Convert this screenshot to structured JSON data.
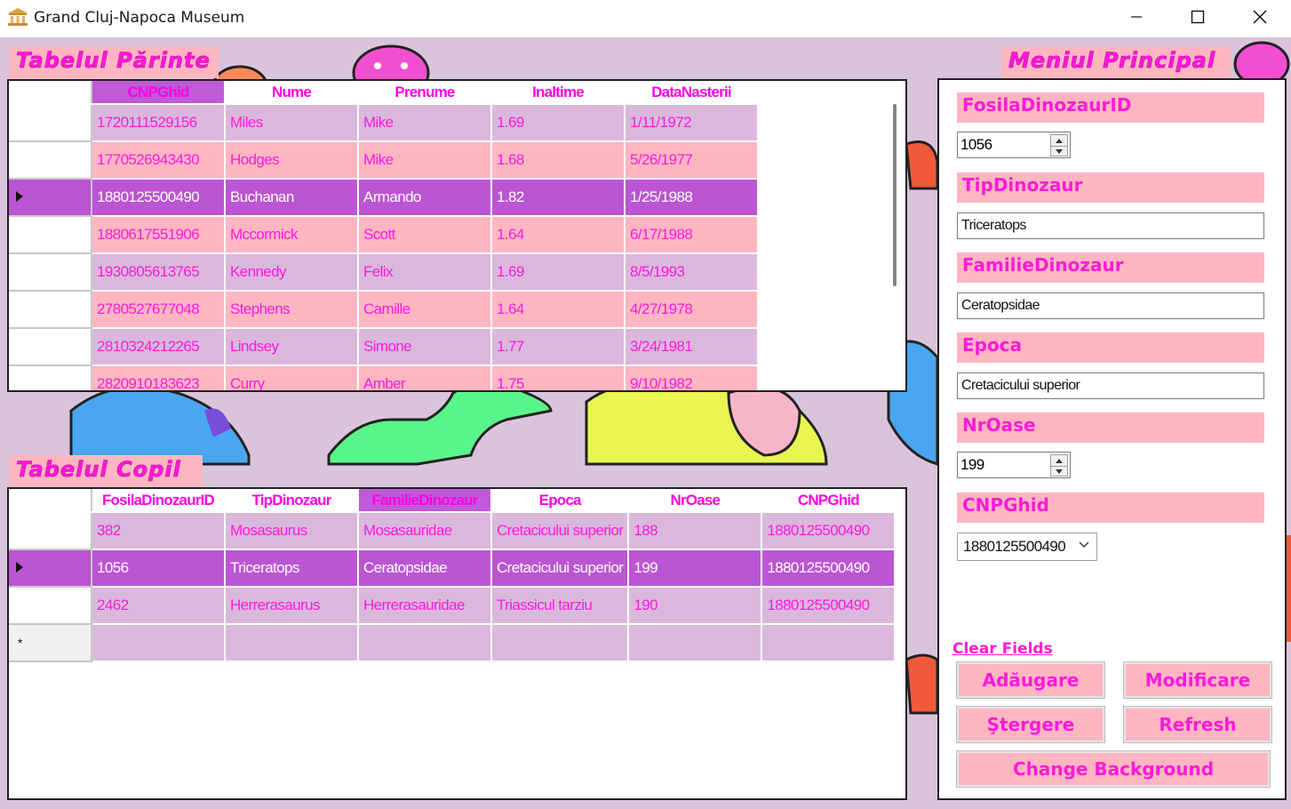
{
  "window": {
    "title": "Grand Cluj-Napoca Museum",
    "icon": "museum-icon"
  },
  "parent_section": {
    "title": "Tabelul Părinte",
    "columns": [
      "CNPGhid",
      "Nume",
      "Prenume",
      "Inaltime",
      "DataNasterii"
    ],
    "selected_column": "CNPGhid",
    "rows": [
      [
        "1720111529156",
        "Miles",
        "Mike",
        "1.69",
        "1/11/1972"
      ],
      [
        "1770526943430",
        "Hodges",
        "Mike",
        "1.68",
        "5/26/1977"
      ],
      [
        "1880125500490",
        "Buchanan",
        "Armando",
        "1.82",
        "1/25/1988"
      ],
      [
        "1880617551906",
        "Mccormick",
        "Scott",
        "1.64",
        "6/17/1988"
      ],
      [
        "1930805613765",
        "Kennedy",
        "Felix",
        "1.69",
        "8/5/1993"
      ],
      [
        "2780527677048",
        "Stephens",
        "Camille",
        "1.64",
        "4/27/1978"
      ],
      [
        "2810324212265",
        "Lindsey",
        "Simone",
        "1.77",
        "3/24/1981"
      ],
      [
        "2820910183623",
        "Curry",
        "Amber",
        "1.75",
        "9/10/1982"
      ]
    ],
    "selected_row": 2
  },
  "child_section": {
    "title": "Tabelul Copil",
    "columns": [
      "FosilaDinozaurID",
      "TipDinozaur",
      "FamilieDinozaur",
      "Epoca",
      "NrOase",
      "CNPGhid"
    ],
    "selected_column": "FamilieDinozaur",
    "rows": [
      [
        "382",
        "Mosasaurus",
        "Mosasauridae",
        "Cretacicului superior",
        "188",
        "1880125500490"
      ],
      [
        "1056",
        "Triceratops",
        "Ceratopsidae",
        "Cretacicului superior",
        "199",
        "1880125500490"
      ],
      [
        "2462",
        "Herrerasaurus",
        "Herrerasauridae",
        "Triassicul tarziu",
        "190",
        "1880125500490"
      ]
    ],
    "selected_row": 1
  },
  "menu": {
    "title": "Meniul Principal",
    "fields": {
      "fosila_label": "FosilaDinozaurID",
      "fosila_value": "1056",
      "tip_label": "TipDinozaur",
      "tip_value": "Triceratops",
      "familie_label": "FamilieDinozaur",
      "familie_value": "Ceratopsidae",
      "epoca_label": "Epoca",
      "epoca_value": "Cretacicului superior",
      "nroase_label": "NrOase",
      "nroase_value": "199",
      "cnp_label": "CNPGhid",
      "cnp_value": "1880125500490"
    },
    "clear_link": "Clear Fields",
    "buttons": {
      "add": "Adăugare",
      "modify": "Modificare",
      "delete": "Ştergere",
      "refresh": "Refresh",
      "background": "Change Background"
    }
  },
  "colors": {
    "accent_text": "#ff1ad9",
    "pink": "#ffb6c1",
    "lavender": "#dab8dc",
    "selected": "#bb55d3",
    "background": "#d9c4dc"
  }
}
